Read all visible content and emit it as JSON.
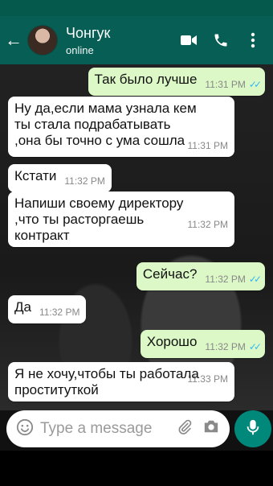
{
  "header": {
    "contact_name": "Чонгук",
    "status": "online",
    "back_icon": "arrow-left-icon",
    "video_icon": "video-camera-icon",
    "call_icon": "phone-icon",
    "menu_icon": "more-vertical-icon"
  },
  "messages": [
    {
      "direction": "out",
      "text": "Так было лучше",
      "time": "11:31 PM",
      "read": true
    },
    {
      "direction": "in",
      "text": "Ну да,если мама узнала кем\nты стала подрабатывать\n,она бы точно с ума сошла",
      "time": "11:31 PM"
    },
    {
      "direction": "in",
      "text": "Кстати",
      "time": "11:32 PM"
    },
    {
      "direction": "in",
      "text": "Напиши своему директору\n,что ты расторгаешь\nконтракт",
      "time": "11:32 PM"
    },
    {
      "direction": "out",
      "text": "Сейчас?",
      "time": "11:32 PM",
      "read": true
    },
    {
      "direction": "in",
      "text": "Да",
      "time": "11:32 PM"
    },
    {
      "direction": "out",
      "text": "Хорошо",
      "time": "11:32 PM",
      "read": true
    },
    {
      "direction": "in",
      "text": "Я не хочу,чтобы ты работала\nпроституткой",
      "time": "11:33 PM"
    }
  ],
  "composer": {
    "placeholder": "Type a message",
    "emoji_icon": "emoji-icon",
    "attach_icon": "paperclip-icon",
    "camera_icon": "camera-icon",
    "mic_icon": "microphone-icon"
  },
  "colors": {
    "header": "#075e54",
    "outgoing": "#dcf8c6",
    "incoming": "#ffffff",
    "read_ticks": "#34b7f1",
    "mic_button": "#00897b"
  }
}
